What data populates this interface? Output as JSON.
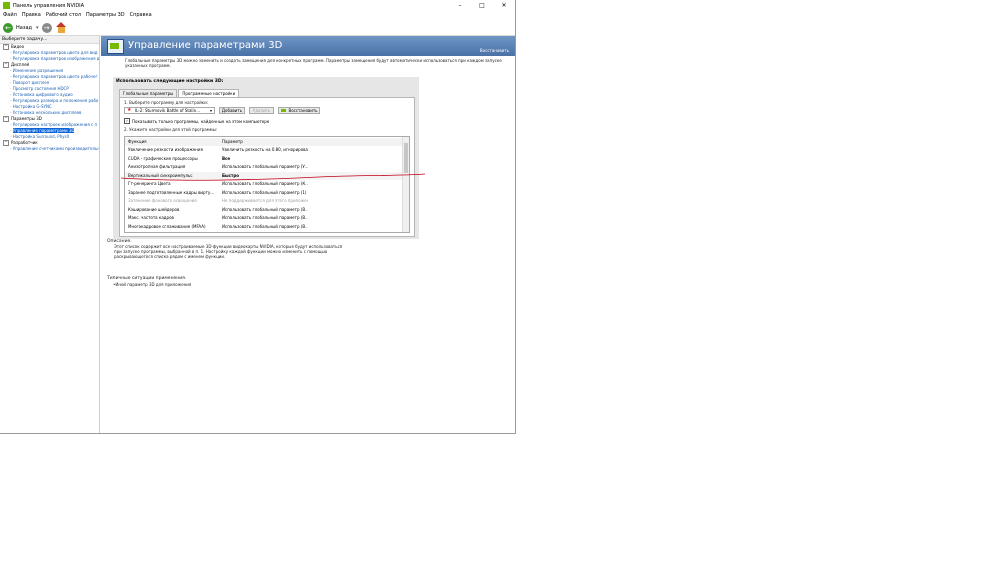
{
  "window": {
    "title": "Панель управления NVIDIA"
  },
  "menu": [
    "Файл",
    "Правка",
    "Рабочий стол",
    "Параметры 3D",
    "Справка"
  ],
  "toolbar": {
    "back_label": "Назад"
  },
  "sidebar": {
    "header": "Выберите задачу...",
    "items": [
      {
        "label": "Видео",
        "type": "cat"
      },
      {
        "label": "Регулировка параметров цвета для вид",
        "type": "child"
      },
      {
        "label": "Регулировка параметров изображения д",
        "type": "child"
      },
      {
        "label": "Дисплей",
        "type": "cat"
      },
      {
        "label": "Изменение разрешения",
        "type": "child"
      },
      {
        "label": "Регулировка параметров цвета рабочег",
        "type": "child"
      },
      {
        "label": "Поворот дисплея",
        "type": "child"
      },
      {
        "label": "Просмотр состояния HDCP",
        "type": "child"
      },
      {
        "label": "Установка цифрового аудио",
        "type": "child"
      },
      {
        "label": "Регулировка размера и положения рабо",
        "type": "child"
      },
      {
        "label": "Настройка G-SYNC",
        "type": "child"
      },
      {
        "label": "Установка нескольких дисплеев",
        "type": "child"
      },
      {
        "label": "Параметры 3D",
        "type": "cat"
      },
      {
        "label": "Регулировка настроек изображения с п",
        "type": "child"
      },
      {
        "label": "Управление параметрами 3D",
        "type": "child",
        "selected": true
      },
      {
        "label": "Настройка Surround, PhysX",
        "type": "child"
      },
      {
        "label": "Разработчик",
        "type": "cat"
      },
      {
        "label": "Управление счетчиками производительн",
        "type": "child"
      }
    ]
  },
  "main": {
    "title": "Управление параметрами 3D",
    "restore_link": "Восстановить",
    "description": "Глобальные параметры 3D можно заменить и создать замещения для конкретных программ. Параметры замещения будут автоматически использоваться при каждом запуске указанных программ.",
    "panel_title": "Использовать следующие настройки 3D:",
    "tabs": [
      "Глобальные параметры",
      "Программные настройки"
    ],
    "step1": "1. Выберите программу для настройки:",
    "program": "IL-2: Sturmovik Battle of Stalin...",
    "add_btn": "Добавить",
    "remove_btn": "Удалить",
    "restore_btn": "Восстановить",
    "checkbox_label": "Показывать только программы, найденные на этом компьютере",
    "step2": "2. Укажите настройки для этой программы:",
    "table_header": {
      "func": "Функция",
      "param": "Параметр"
    },
    "rows": [
      {
        "func": "Увеличение резкости изображения",
        "param": "Увеличить резкость на 0.80, игнорирова...",
        "style": ""
      },
      {
        "func": "CUDA - графические процессоры",
        "param": "Все",
        "style": "bold"
      },
      {
        "func": "Анизотропная фильтрация",
        "param": "Использовать глобальный параметр (У...",
        "style": ""
      },
      {
        "func": "Вертикальный синхроимпульс",
        "param": "Быстро",
        "style": "bold sel"
      },
      {
        "func": "Гт-ренеринга Цвета",
        "param": "Использовать глобальный параметр (К...",
        "style": ""
      },
      {
        "func": "Заранее подготовленные кадры вирту...",
        "param": "Использовать глобальный параметр (1)",
        "style": ""
      },
      {
        "func": "Затенение фонового освещения",
        "param": "Не поддерживается для этого приложен...",
        "style": "grey"
      },
      {
        "func": "Кэширование шейдеров",
        "param": "Использовать глобальный параметр (В...",
        "style": ""
      },
      {
        "func": "Макс. частота кадров",
        "param": "Использовать глобальный параметр (В...",
        "style": ""
      },
      {
        "func": "Многокадровое сглаживание (MFAA)",
        "param": "Использовать глобальный параметр (В...",
        "style": ""
      }
    ],
    "desc_heading": "Описание.",
    "desc_text": "Этот список содержит все настраиваемые 3D-функции видеокарты NVIDIA, которые будут использоваться при запуске программы, выбранной в п. 1. Настройку каждой функции можно изменить с помощью раскрывающегося списка рядом с именем функции.",
    "typical_heading": "Типичные ситуации применения.",
    "typical_item": "•Иной параметр 3D для приложения"
  },
  "colors": {
    "banner": "#5a81b6",
    "accent": "#76b900",
    "selection": "#0a64d8",
    "annotation": "#c0001a"
  }
}
